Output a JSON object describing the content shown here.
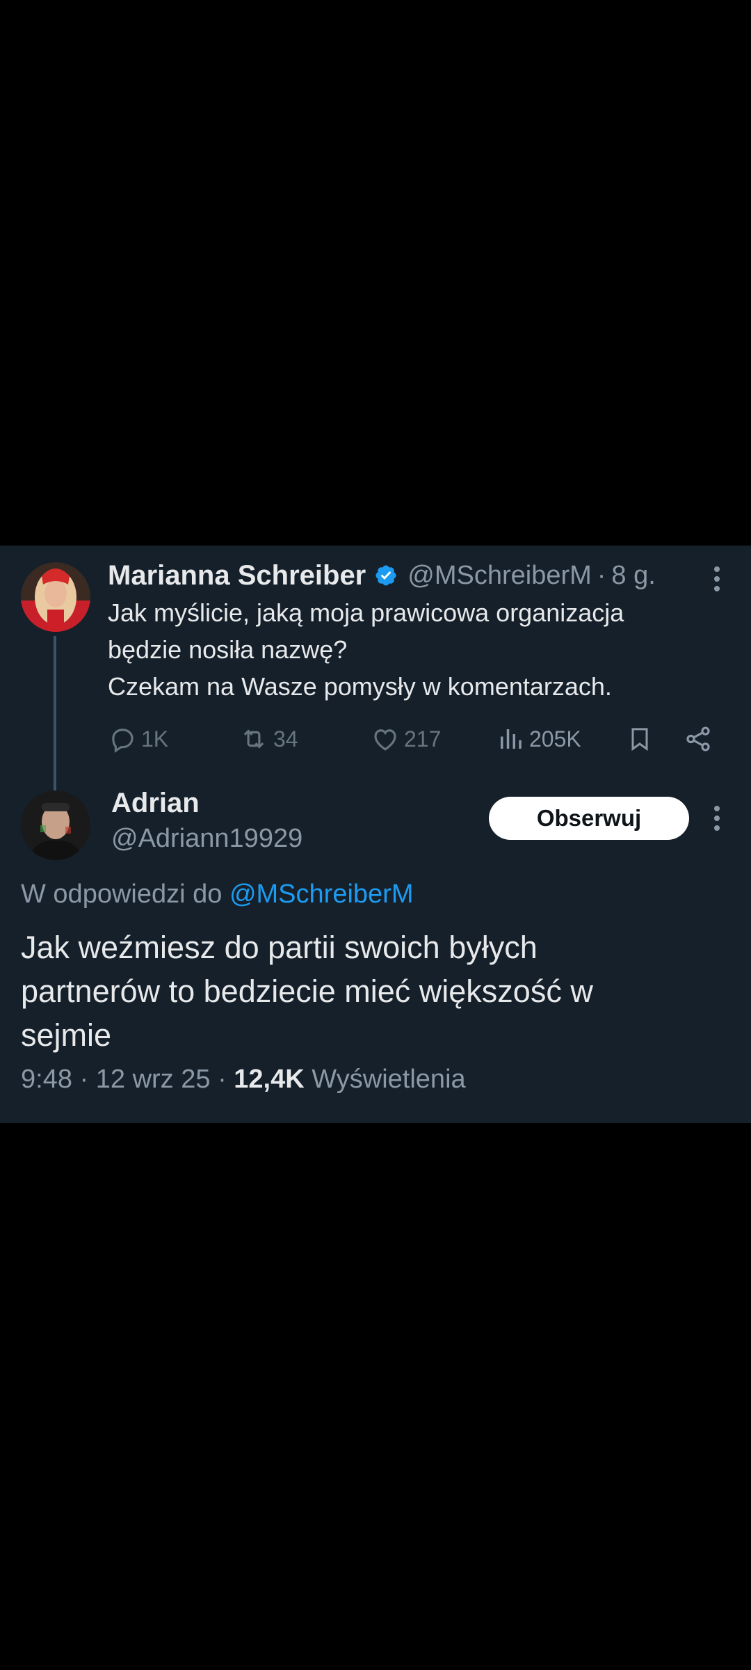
{
  "parent_tweet": {
    "author_name": "Marianna Schreiber",
    "handle": "@MSchreiberM",
    "separator": "·",
    "time": "8 g.",
    "text_lines": [
      "Jak myślicie, jaką moja prawicowa organizacja",
      "będzie nosiła nazwę?",
      "Czekam na Wasze pomysły w komentarzach."
    ],
    "actions": {
      "replies": "1K",
      "retweets": "34",
      "likes": "217",
      "views": "205K"
    },
    "icons": [
      "verified-badge-icon",
      "more-options-icon",
      "reply-icon",
      "retweet-icon",
      "like-icon",
      "views-icon",
      "bookmark-icon",
      "share-icon"
    ]
  },
  "reply_tweet": {
    "author_name": "Adrian",
    "handle": "@Adriann19929",
    "follow_label": "Obserwuj",
    "reply_to_prefix": "W odpowiedzi do",
    "reply_to_mention": "@MSchreiberM",
    "text_lines": [
      "Jak weźmiesz do partii swoich byłych",
      "partnerów to bedziecie mieć większość w",
      "sejmie"
    ],
    "time": "9:48",
    "separator": "·",
    "date": "12 wrz 25",
    "views_count": "12,4K",
    "views_label": "Wyświetlenia"
  },
  "colors": {
    "background": "#000000",
    "card": "#15202b",
    "text": "#e7e9ea",
    "muted": "#8b98a5",
    "accent": "#1d9bf0",
    "verified": "#1d9bf0"
  }
}
